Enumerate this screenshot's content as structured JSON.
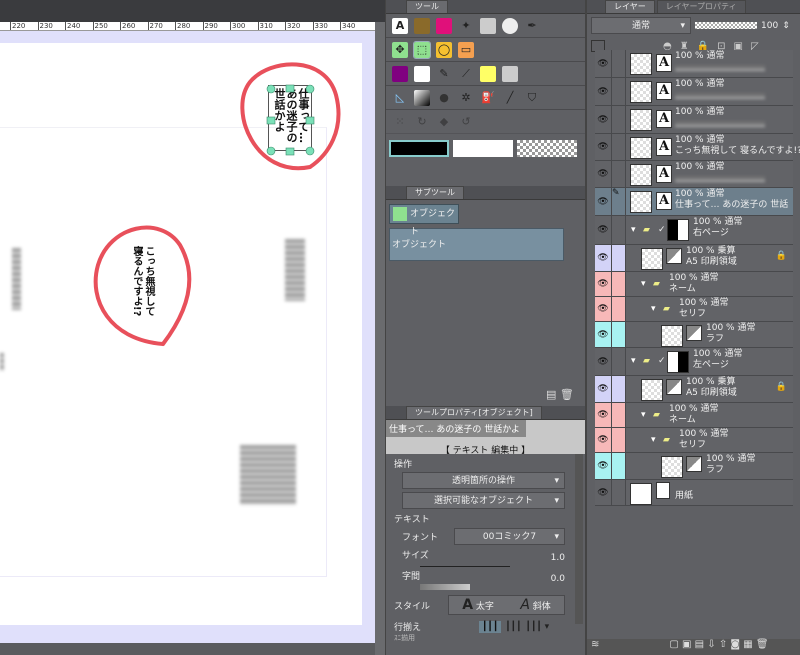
{
  "canvas": {
    "ruler_ticks": [
      "220",
      "230",
      "240",
      "250",
      "260",
      "270",
      "280",
      "290",
      "300",
      "310",
      "320",
      "330",
      "340"
    ],
    "bubbles": [
      {
        "text": "仕事って…\nあの迷子の\n世話かよ"
      },
      {
        "text": "こっち無視して\n寝るんですよ!?"
      }
    ]
  },
  "tool_panel": {
    "tab": "ツール"
  },
  "subtool_panel": {
    "tab": "サブツール",
    "group_button": "オブジェクト",
    "selected_item": "オブジェクト"
  },
  "tool_property": {
    "tab": "ツールプロパティ[オブジェクト]",
    "preview_text": "仕事って… あの迷子の 世話かよ",
    "editing_status": "【 テキスト 編集中 】",
    "section_operation": "操作",
    "transparent_op": "透明箇所の操作",
    "selectable_obj": "選択可能なオブジェクト",
    "section_text": "テキスト",
    "font_label": "フォント",
    "font_value": "00コミック7",
    "size_label": "サイズ",
    "size_value": "1.0",
    "spacing_label": "字間",
    "spacing_value": "0.0",
    "style_label": "スタイル",
    "bold": "太字",
    "italic": "斜体",
    "align_label": "行揃え",
    "cut_label": "ｽﾆ揃用"
  },
  "layer_panel": {
    "tab_layer": "レイヤー",
    "tab_property": "レイヤープロパティ",
    "blend_mode": "通常",
    "opacity": "100",
    "layers": [
      {
        "opacity": "100 % 通常",
        "name": "",
        "type": "text",
        "blurred": true
      },
      {
        "opacity": "100 % 通常",
        "name": "",
        "type": "text",
        "blurred": true
      },
      {
        "opacity": "100 % 通常",
        "name": "",
        "type": "text",
        "blurred": true
      },
      {
        "opacity": "100 % 通常",
        "name": "こっち無視して 寝るんですよ!?",
        "type": "text"
      },
      {
        "opacity": "100 % 通常",
        "name": "",
        "type": "text",
        "blurred": true
      },
      {
        "opacity": "100 % 通常",
        "name": "仕事って… あの迷子の 世話",
        "type": "text",
        "selected": true
      },
      {
        "opacity": "100 % 通常",
        "name": "右ページ",
        "type": "folder-page",
        "indent": 0
      },
      {
        "opacity": "100 % 乗算",
        "name": "A5 印刷領域",
        "type": "raster",
        "indent": 1,
        "color": "#d3d3f7",
        "locked": true
      },
      {
        "opacity": "100 % 通常",
        "name": "ネーム",
        "type": "folder",
        "indent": 1,
        "color": "#f7b8b8"
      },
      {
        "opacity": "100 % 通常",
        "name": "セリフ",
        "type": "folder",
        "indent": 2,
        "color": "#f7b8b8"
      },
      {
        "opacity": "100 % 通常",
        "name": "ラフ",
        "type": "raster",
        "indent": 3,
        "color": "#a8f2f2"
      },
      {
        "opacity": "100 % 通常",
        "name": "左ページ",
        "type": "folder-page",
        "indent": 0
      },
      {
        "opacity": "100 % 乗算",
        "name": "A5 印刷領域",
        "type": "raster",
        "indent": 1,
        "color": "#d3d3f7",
        "locked": true
      },
      {
        "opacity": "100 % 通常",
        "name": "ネーム",
        "type": "folder",
        "indent": 1,
        "color": "#f7b8b8"
      },
      {
        "opacity": "100 % 通常",
        "name": "セリフ",
        "type": "folder",
        "indent": 2,
        "color": "#f7b8b8"
      },
      {
        "opacity": "100 % 通常",
        "name": "ラフ",
        "type": "raster",
        "indent": 3,
        "color": "#a8f2f2"
      },
      {
        "opacity": "",
        "name": "用紙",
        "type": "paper"
      }
    ]
  },
  "colors": {
    "annotation": "#e8505b",
    "selected_layer": "#6d7f8c"
  }
}
